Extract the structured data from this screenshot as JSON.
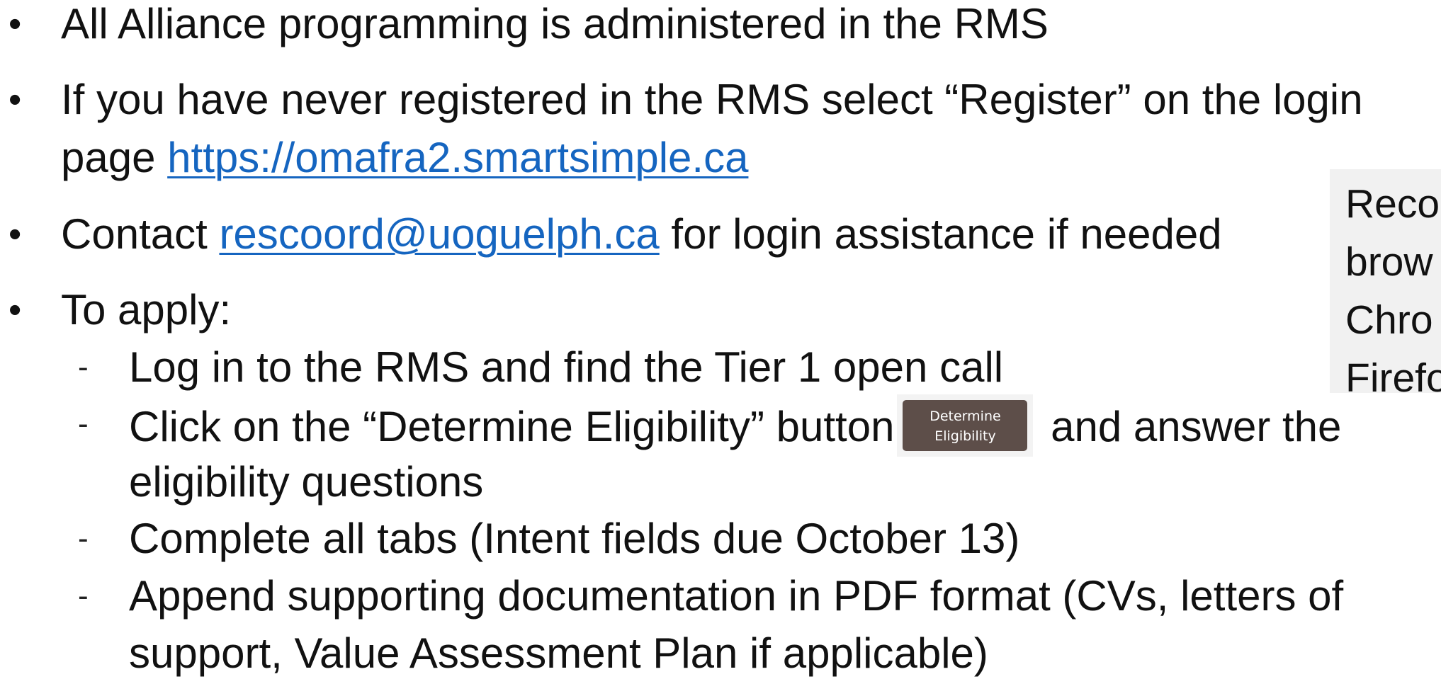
{
  "bullets": {
    "b1": {
      "text": "All Alliance programming is administered in the RMS"
    },
    "b2": {
      "text_line1": "If you have never registered in the RMS select “Register” on the login",
      "text_line2_prefix": "page ",
      "link": "https://omafra2.smartsimple.ca"
    },
    "b3": {
      "prefix": "Contact ",
      "email": "rescoord@uoguelph.ca",
      "suffix": " for login assistance if needed"
    },
    "b4": {
      "text": "To apply:"
    }
  },
  "sub_items": {
    "s1": {
      "text": "Log in to the RMS and find the Tier 1 open call"
    },
    "s2": {
      "prefix": "Click on the “Determine Eligibility” button",
      "suffix": " and answer the",
      "line2": "eligibility questions"
    },
    "s3": {
      "text": "Complete all tabs (Intent fields due October 13)"
    },
    "s4": {
      "line1": "Append supporting documentation in PDF format (CVs, letters of",
      "line2": "support, Value Assessment Plan if applicable)"
    }
  },
  "button": {
    "line1": "Determine",
    "line2": "Eligibility",
    "bg_color": "#5d4e49"
  },
  "note": {
    "line1": "Reco",
    "line2": "brow",
    "line3": "Chro",
    "line4": "Firefo"
  },
  "colors": {
    "link": "#1565c0",
    "note_bg": "#f1f1f1"
  }
}
